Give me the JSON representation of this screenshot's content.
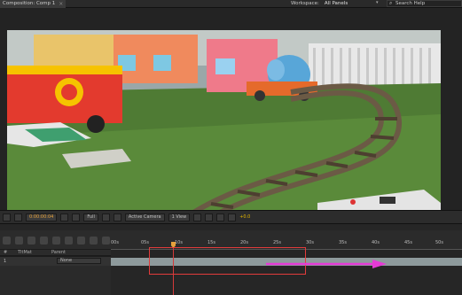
{
  "topbar": {
    "comp_tab": "Composition: Comp 1",
    "close_glyph": "×",
    "workspace_label": "Workspace:",
    "workspace_value": "All Panels",
    "search_placeholder": "Search Help"
  },
  "toolbar": {
    "magnification": "",
    "timecode": "0:00:00:04",
    "resolution": "Full",
    "camera": "Active Camera",
    "views": "1 View",
    "exposure": "+0.0"
  },
  "timeline": {
    "ruler_ticks": [
      "00s",
      "05s",
      "10s",
      "15s",
      "20s",
      "25s",
      "30s",
      "35s",
      "40s",
      "45s",
      "50s"
    ],
    "layer_columns": {
      "hash": "#",
      "name": "TItMat",
      "parent": "Parent"
    },
    "layer": {
      "num": "1",
      "name": "",
      "parent": "None"
    }
  },
  "colors": {
    "annotation_box": "#e23b3b",
    "annotation_arrow": "#e63ad6",
    "cti": "#e6a23c",
    "layer_bar": "#8e9a9c"
  }
}
